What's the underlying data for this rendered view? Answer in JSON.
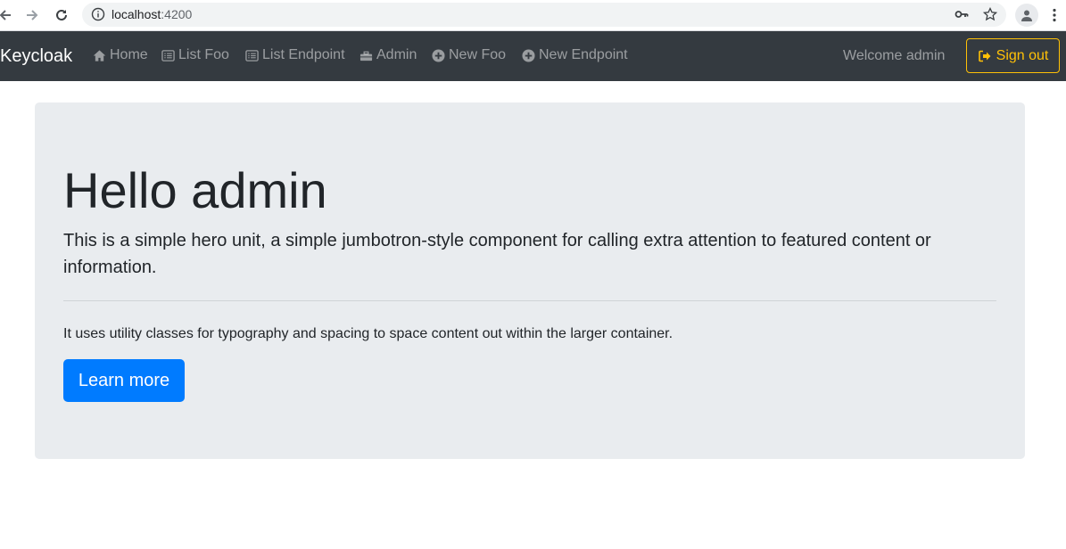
{
  "browser": {
    "url_host": "localhost",
    "url_port": ":4200",
    "icons": [
      "back-icon",
      "forward-icon",
      "reload-icon",
      "info-icon",
      "key-icon",
      "star-icon",
      "profile-icon",
      "menu-dots-icon"
    ]
  },
  "navbar": {
    "brand": "Keycloak",
    "links": [
      {
        "label": "Home",
        "icon": "home-icon"
      },
      {
        "label": "List Foo",
        "icon": "list-icon"
      },
      {
        "label": "List Endpoint",
        "icon": "list-icon"
      },
      {
        "label": "Admin",
        "icon": "admin-icon"
      },
      {
        "label": "New Foo",
        "icon": "plus-circle-icon"
      },
      {
        "label": "New Endpoint",
        "icon": "plus-circle-icon"
      }
    ],
    "welcome": "Welcome admin",
    "signout": "Sign out"
  },
  "hero": {
    "title": "Hello admin",
    "lead": "This is a simple hero unit, a simple jumbotron-style component for calling extra attention to featured content or information.",
    "text": "It uses utility classes for typography and spacing to space content out within the larger container.",
    "button": "Learn more"
  },
  "colors": {
    "navbar_bg": "#343a40",
    "jumbotron_bg": "#e9ecef",
    "primary": "#007bff",
    "warning": "#ffc107"
  }
}
